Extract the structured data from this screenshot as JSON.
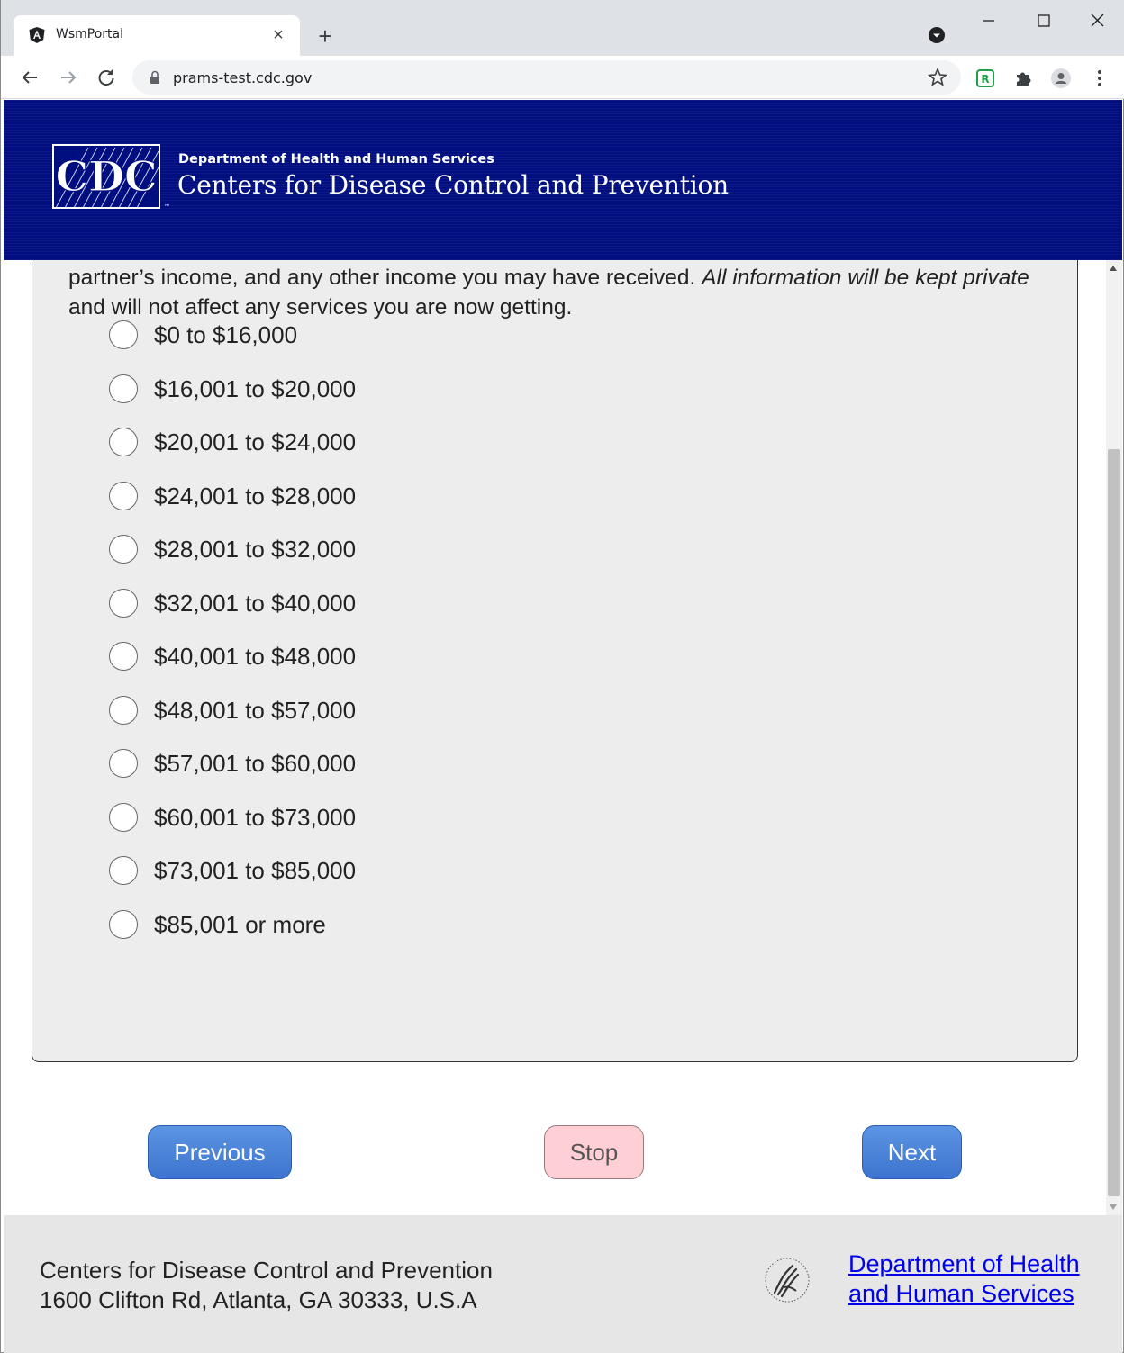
{
  "browser": {
    "tab_title": "WsmPortal",
    "tab_close": "×",
    "new_tab": "+",
    "url": "prams-test.cdc.gov"
  },
  "header": {
    "logo_text": "CDC",
    "department": "Department of Health and Human Services",
    "agency": "Centers for Disease Control and Prevention"
  },
  "question": {
    "text_plain_before": "partner’s income, and any other income you may have received. ",
    "text_italic": "All information will be kept private",
    "text_plain_after": " and will not affect any services you are now getting."
  },
  "options": [
    "$0 to $16,000",
    "$16,001 to $20,000",
    "$20,001 to $24,000",
    "$24,001 to $28,000",
    "$28,001 to $32,000",
    "$32,001 to $40,000",
    "$40,001 to $48,000",
    "$48,001 to $57,000",
    "$57,001 to $60,000",
    "$60,001 to $73,000",
    "$73,001 to $85,000",
    "$85,001 or more"
  ],
  "buttons": {
    "previous": "Previous",
    "stop": "Stop",
    "next": "Next"
  },
  "footer": {
    "org_line1": "Centers for Disease Control and Prevention",
    "org_line2": "1600 Clifton Rd, Atlanta, GA 30333, U.S.A",
    "hhs_link_line1": "Department of Health",
    "hhs_link_line2": "and Human Services"
  },
  "colors": {
    "header_bg": "#000e80",
    "button_blue": "#3d74cf",
    "stop_pink": "#ffcfd6",
    "card_bg": "#ededed",
    "footer_bg": "#e6e6e6"
  },
  "icons": [
    "angular-favicon-icon",
    "close-icon",
    "plus-icon",
    "profile-dot-icon",
    "minimize-icon",
    "maximize-icon",
    "window-close-icon",
    "back-arrow-icon",
    "forward-arrow-icon",
    "reload-icon",
    "lock-icon",
    "star-icon",
    "extension-r-icon",
    "puzzle-icon",
    "account-icon",
    "kebab-menu-icon",
    "hhs-eagle-icon"
  ]
}
